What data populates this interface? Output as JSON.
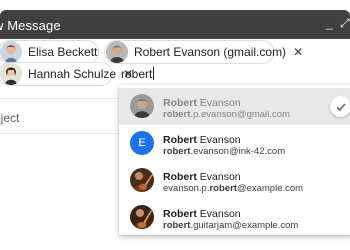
{
  "window": {
    "title": "w Message",
    "minimize_icon": "_",
    "expand_icon": "⤢"
  },
  "recipients": [
    {
      "name": "Elisa Beckett",
      "remove": "✕"
    },
    {
      "name": "Robert Evanson (gmail.com)",
      "remove": "✕"
    },
    {
      "name": "Hannah Schulze",
      "remove": "✕"
    }
  ],
  "to_input": {
    "value": "robert"
  },
  "subject": {
    "placeholder": "oject"
  },
  "suggestions": [
    {
      "name_bold": "Robert",
      "name_rest": " Evanson",
      "email_bold": "robert",
      "email_rest": ".p.evanson@gmail.com",
      "avatar": "photo-man-gray",
      "selected": true
    },
    {
      "name_bold": "Robert",
      "name_rest": " Evanson",
      "email_bold": "robert",
      "email_rest": ".evanson@ink-42.com",
      "avatar_letter": "E",
      "avatar_color": "#1a73e8"
    },
    {
      "name_bold": "Robert",
      "name_rest": " Evanson",
      "email_pre": "evanson.p.",
      "email_bold": "robert",
      "email_rest": "@example.com",
      "avatar": "photo-guitar"
    },
    {
      "name_bold": "Robert",
      "name_rest": " Evanson",
      "email_bold": "robert",
      "email_rest": ".guitarjam@example.com",
      "avatar": "photo-guitar-2"
    }
  ],
  "colors": {
    "titlebar": "#404040",
    "selected_row": "#e8e8e8",
    "accent": "#1a73e8"
  }
}
